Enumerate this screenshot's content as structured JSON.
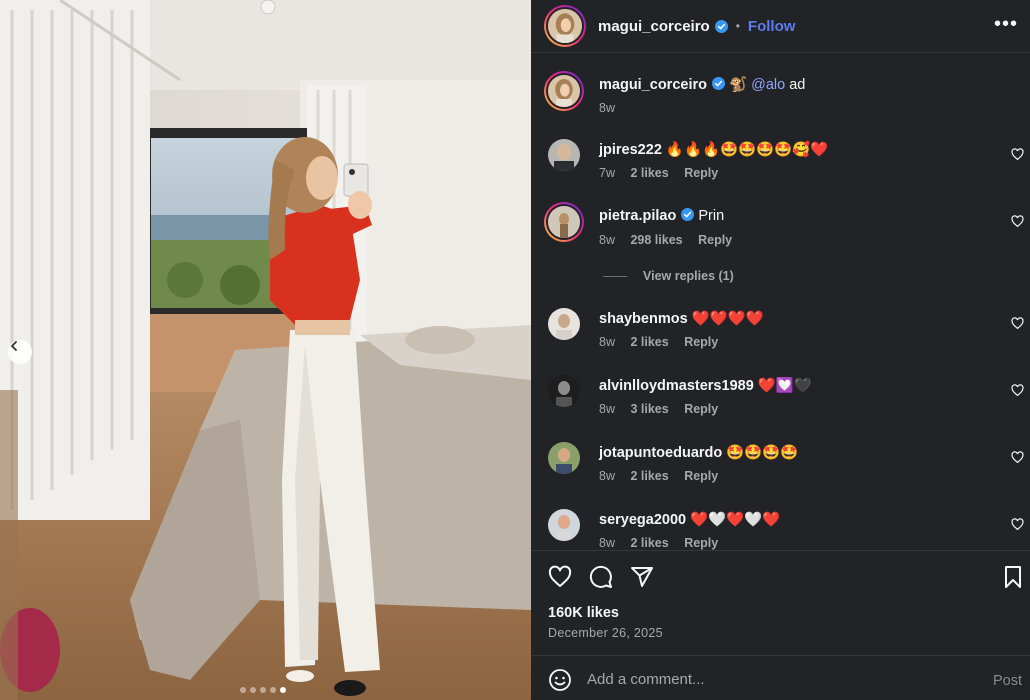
{
  "post": {
    "author": "magui_corceiro",
    "follow_label": "Follow",
    "separator": "•",
    "more_label": "•••",
    "caption": {
      "user": "magui_corceiro",
      "emoji": "🐒",
      "mention": "@alo",
      "text": "ad",
      "time": "8w"
    },
    "likes_label": "160K likes",
    "date": "December 26, 2025",
    "carousel": {
      "total": 5,
      "active_index": 4
    }
  },
  "comments": [
    {
      "user": "jpires222",
      "text": "🔥🔥🔥🤩🤩🤩🤩🥰❤️",
      "time": "7w",
      "likes": "2 likes",
      "reply": "Reply",
      "verified": false
    },
    {
      "user": "pietra.pilao",
      "text": "Prin",
      "time": "8w",
      "likes": "298 likes",
      "reply": "Reply",
      "verified": true,
      "view_replies": "View replies (1)"
    },
    {
      "user": "shaybenmos",
      "text": "❤️❤️❤️❤️",
      "time": "8w",
      "likes": "2 likes",
      "reply": "Reply",
      "verified": false
    },
    {
      "user": "alvinlloydmasters1989",
      "text": "❤️💟🖤",
      "time": "8w",
      "likes": "3 likes",
      "reply": "Reply",
      "verified": false
    },
    {
      "user": "jotapuntoeduardo",
      "text": "🤩🤩🤩🤩",
      "time": "8w",
      "likes": "2 likes",
      "reply": "Reply",
      "verified": false
    },
    {
      "user": "seryega2000",
      "text": "❤️🤍❤️🤍❤️",
      "time": "8w",
      "likes": "2 likes",
      "reply": "Reply",
      "verified": false
    }
  ],
  "composer": {
    "placeholder": "Add a comment...",
    "post_label": "Post"
  },
  "colors": {
    "panel_bg": "#222326",
    "link_blue": "#5b7cf0",
    "verified_blue": "#3897f0",
    "muted_text": "#a8a8a8"
  },
  "icons": [
    "chevron-left-icon",
    "verified-icon",
    "more-icon",
    "heart-icon",
    "comment-icon",
    "share-icon",
    "bookmark-icon",
    "emoji-icon"
  ]
}
